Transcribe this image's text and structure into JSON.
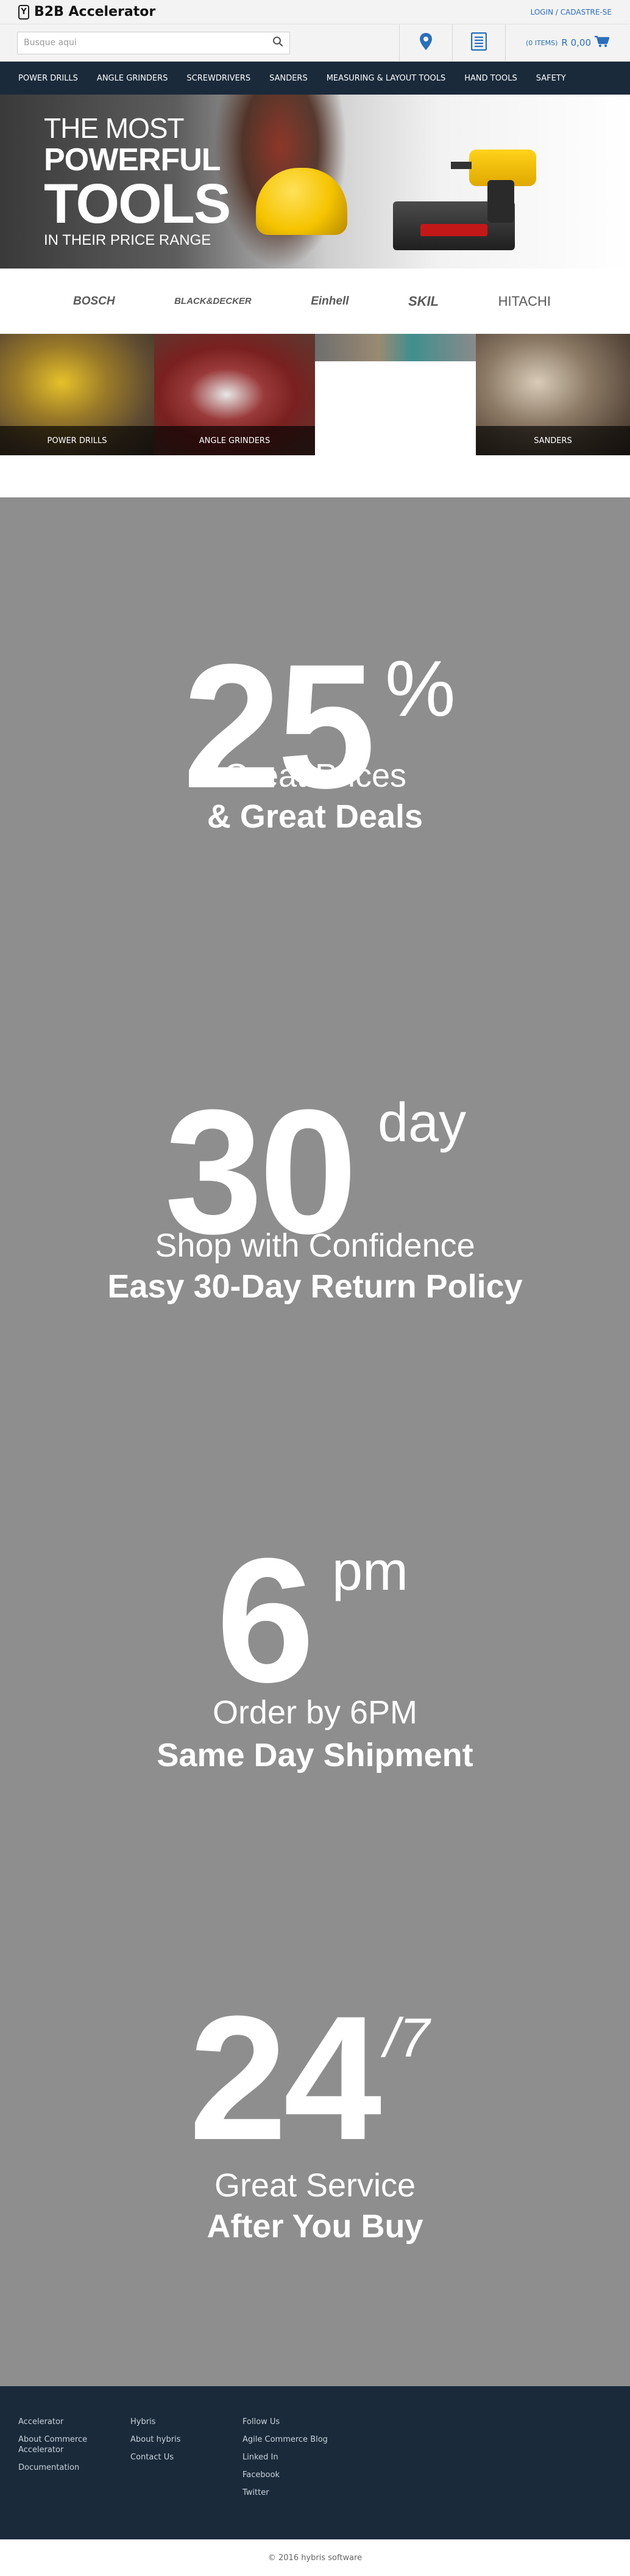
{
  "header": {
    "logo_mark": "Y",
    "logo_text": "B2B Accelerator",
    "login_label": "LOGIN / CADASTRE-SE"
  },
  "search": {
    "placeholder": "Busque aqui"
  },
  "cart": {
    "items_label": "(0 ITEMS)",
    "total": "R 0,00"
  },
  "nav": {
    "items": [
      {
        "label": "POWER DRILLS"
      },
      {
        "label": "ANGLE GRINDERS"
      },
      {
        "label": "SCREWDRIVERS"
      },
      {
        "label": "SANDERS"
      },
      {
        "label": "MEASURING & LAYOUT TOOLS"
      },
      {
        "label": "HAND TOOLS"
      },
      {
        "label": "SAFETY"
      }
    ]
  },
  "hero": {
    "line1": "THE MOST",
    "line2": "POWERFUL",
    "line3": "TOOLS",
    "line4": "IN THEIR PRICE RANGE"
  },
  "brands": [
    "BOSCH",
    "BLACK&DECKER",
    "Einhell",
    "SKIL",
    "HITACHI"
  ],
  "categories": [
    {
      "label": "POWER DRILLS"
    },
    {
      "label": "ANGLE GRINDERS"
    },
    {
      "label": "SANDERS"
    }
  ],
  "promos": [
    {
      "big": "25",
      "sup": "%",
      "line1": "Great Prices",
      "line2": "& Great Deals"
    },
    {
      "big": "30",
      "sup": "day",
      "line1": "Shop with Confidence",
      "line2": "Easy 30-Day Return Policy"
    },
    {
      "big": "6",
      "sup": "pm",
      "line1": "Order by 6PM",
      "line2": "Same Day Shipment"
    },
    {
      "big": "24",
      "sup": "/7",
      "line1": "Great Service",
      "line2": "After You Buy"
    }
  ],
  "footer": {
    "col1": [
      "Accelerator",
      "About Commerce Accelerator",
      "Documentation"
    ],
    "col2": [
      "Hybris",
      "About hybris",
      "Contact Us"
    ],
    "col3": [
      "Follow Us",
      "Agile Commerce Blog",
      "Linked In",
      "Facebook",
      "Twitter"
    ],
    "copyright": "© 2016 hybris software"
  },
  "colors": {
    "nav_bg": "#1a2a3b",
    "accent_blue": "#2a6ebb",
    "promo_bg": "#8e8e8e"
  }
}
